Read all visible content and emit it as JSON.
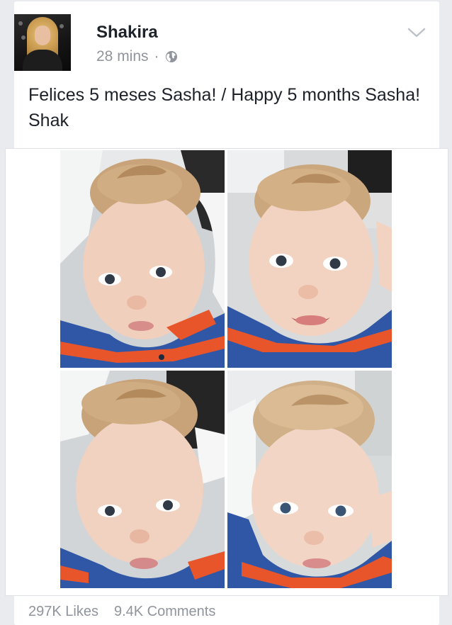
{
  "post": {
    "author": "Shakira",
    "time": "28 mins",
    "separator": "·",
    "privacy_icon": "globe-icon",
    "menu_icon": "chevron-down-icon",
    "text": "Felices 5 meses Sasha! / Happy 5 months Sasha! Shak"
  },
  "footer": {
    "likes": "297K Likes",
    "comments": "9.4K Comments"
  },
  "colors": {
    "background": "#e9ebee",
    "card": "#ffffff",
    "name": "#1d2129",
    "meta": "#90949c",
    "shirt_blue": "#2f57a6",
    "shirt_orange": "#e8552b"
  }
}
